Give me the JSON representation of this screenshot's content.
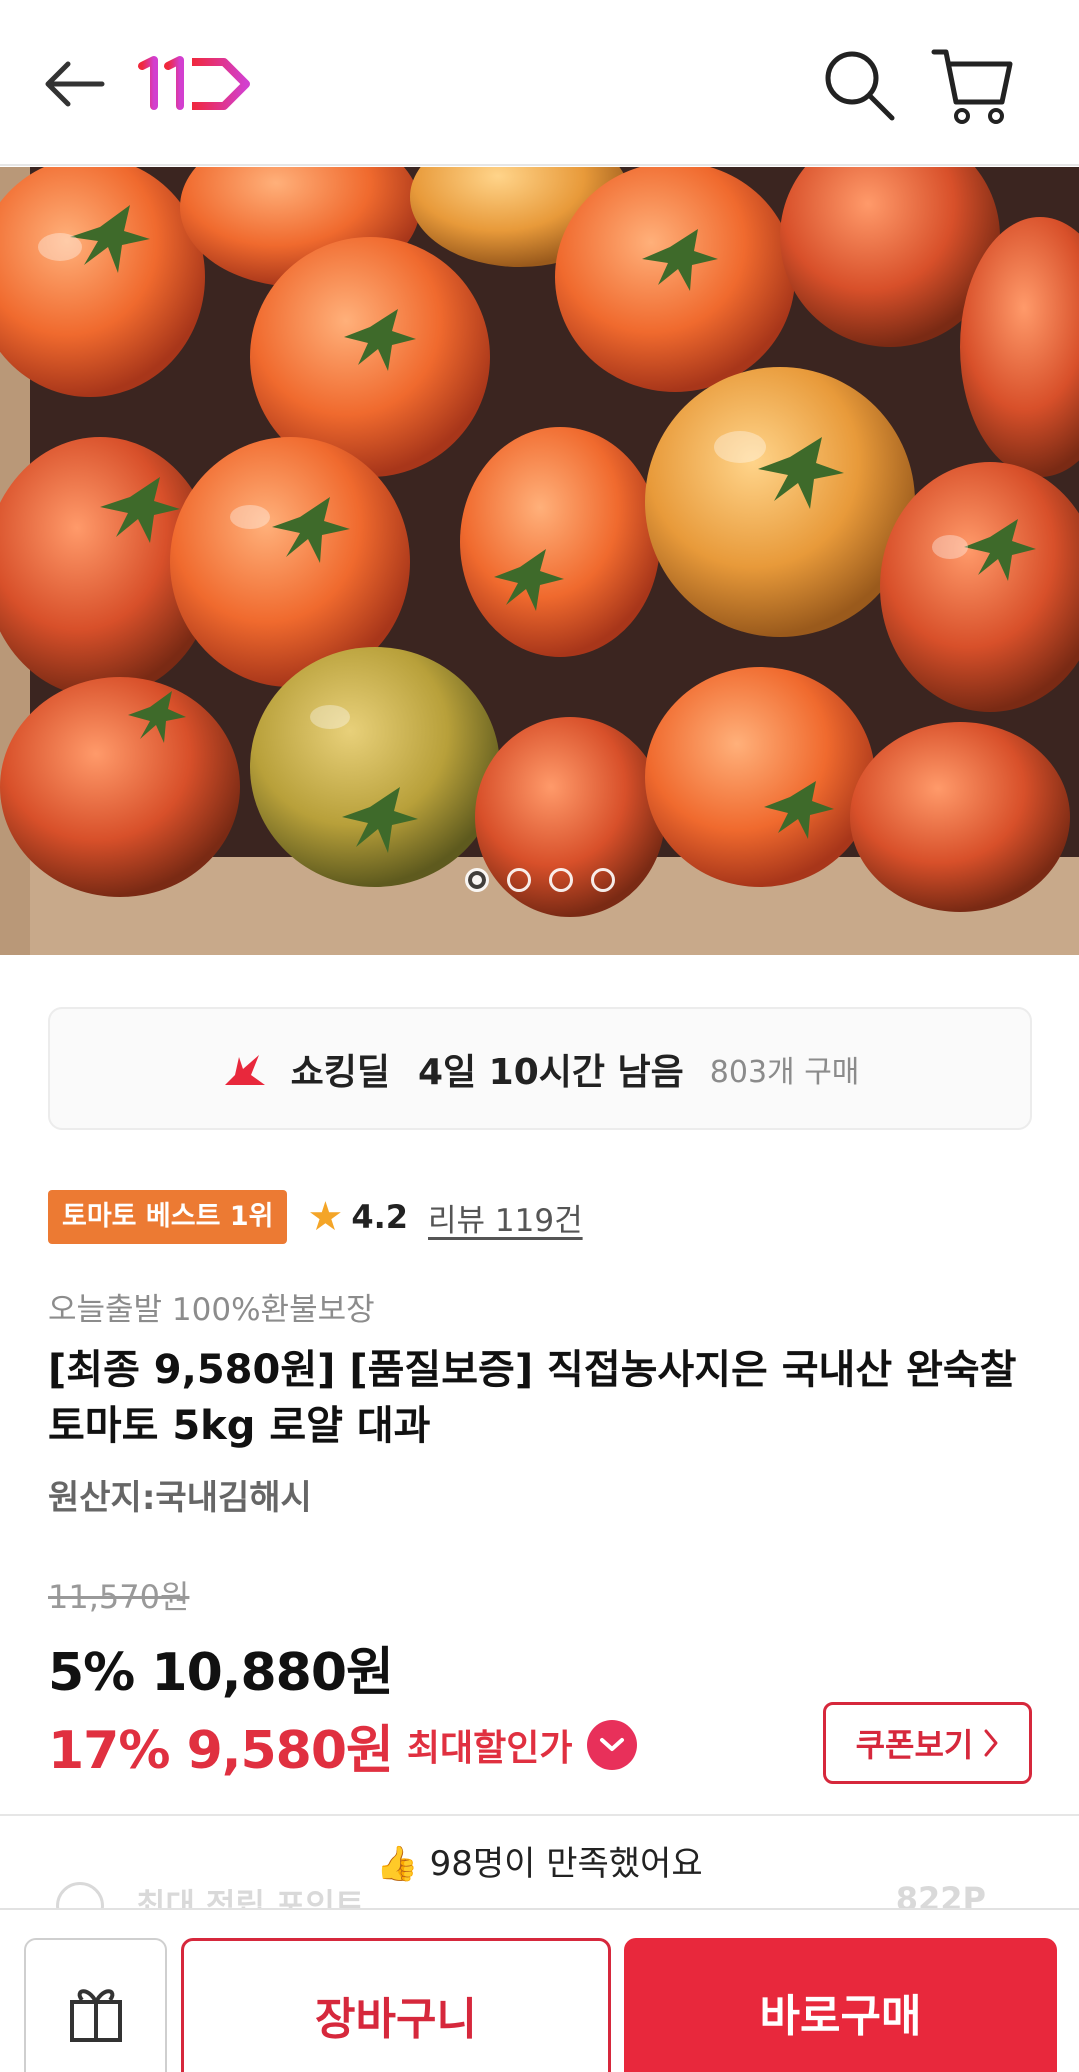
{
  "header": {
    "back_icon": "arrow-left-icon",
    "logo_text": "11",
    "brand_color": "#e8283c",
    "search_icon": "search-icon",
    "cart_icon": "cart-icon"
  },
  "gallery": {
    "image_desc": "tomatoes-photo",
    "dots": 4,
    "active_index": 0
  },
  "deal": {
    "icon": "shocking-deal-icon",
    "name": "쇼킹딜",
    "time_left": "4일 10시간 남음",
    "purchases": "803개 구매"
  },
  "product": {
    "best_badge": "토마토 베스트 1위",
    "rating": "4.2",
    "review_link": "리뷰 119건",
    "subtitle": "오늘출발 100%환불보장",
    "title": "[최종 9,580원] [품질보증] 직접농사지은 국내산 완숙찰 토마토 5kg 로얄 대과",
    "origin": "원산지:국내김해시"
  },
  "price": {
    "original": "11,570원",
    "sale": "5% 10,880원",
    "max_discount": "17% 9,580원",
    "max_label": "최대할인가",
    "coupon_button": "쿠폰보기",
    "accent_color": "#e03040"
  },
  "satisfaction": {
    "icon": "👍",
    "text": "98명이 만족했어요"
  },
  "ghost": {
    "left_text": "최대 적립 포인트",
    "right_text": "822P"
  },
  "bottom": {
    "gift_icon": "gift-icon",
    "cart_button": "장바구니",
    "buy_button": "바로구매"
  }
}
